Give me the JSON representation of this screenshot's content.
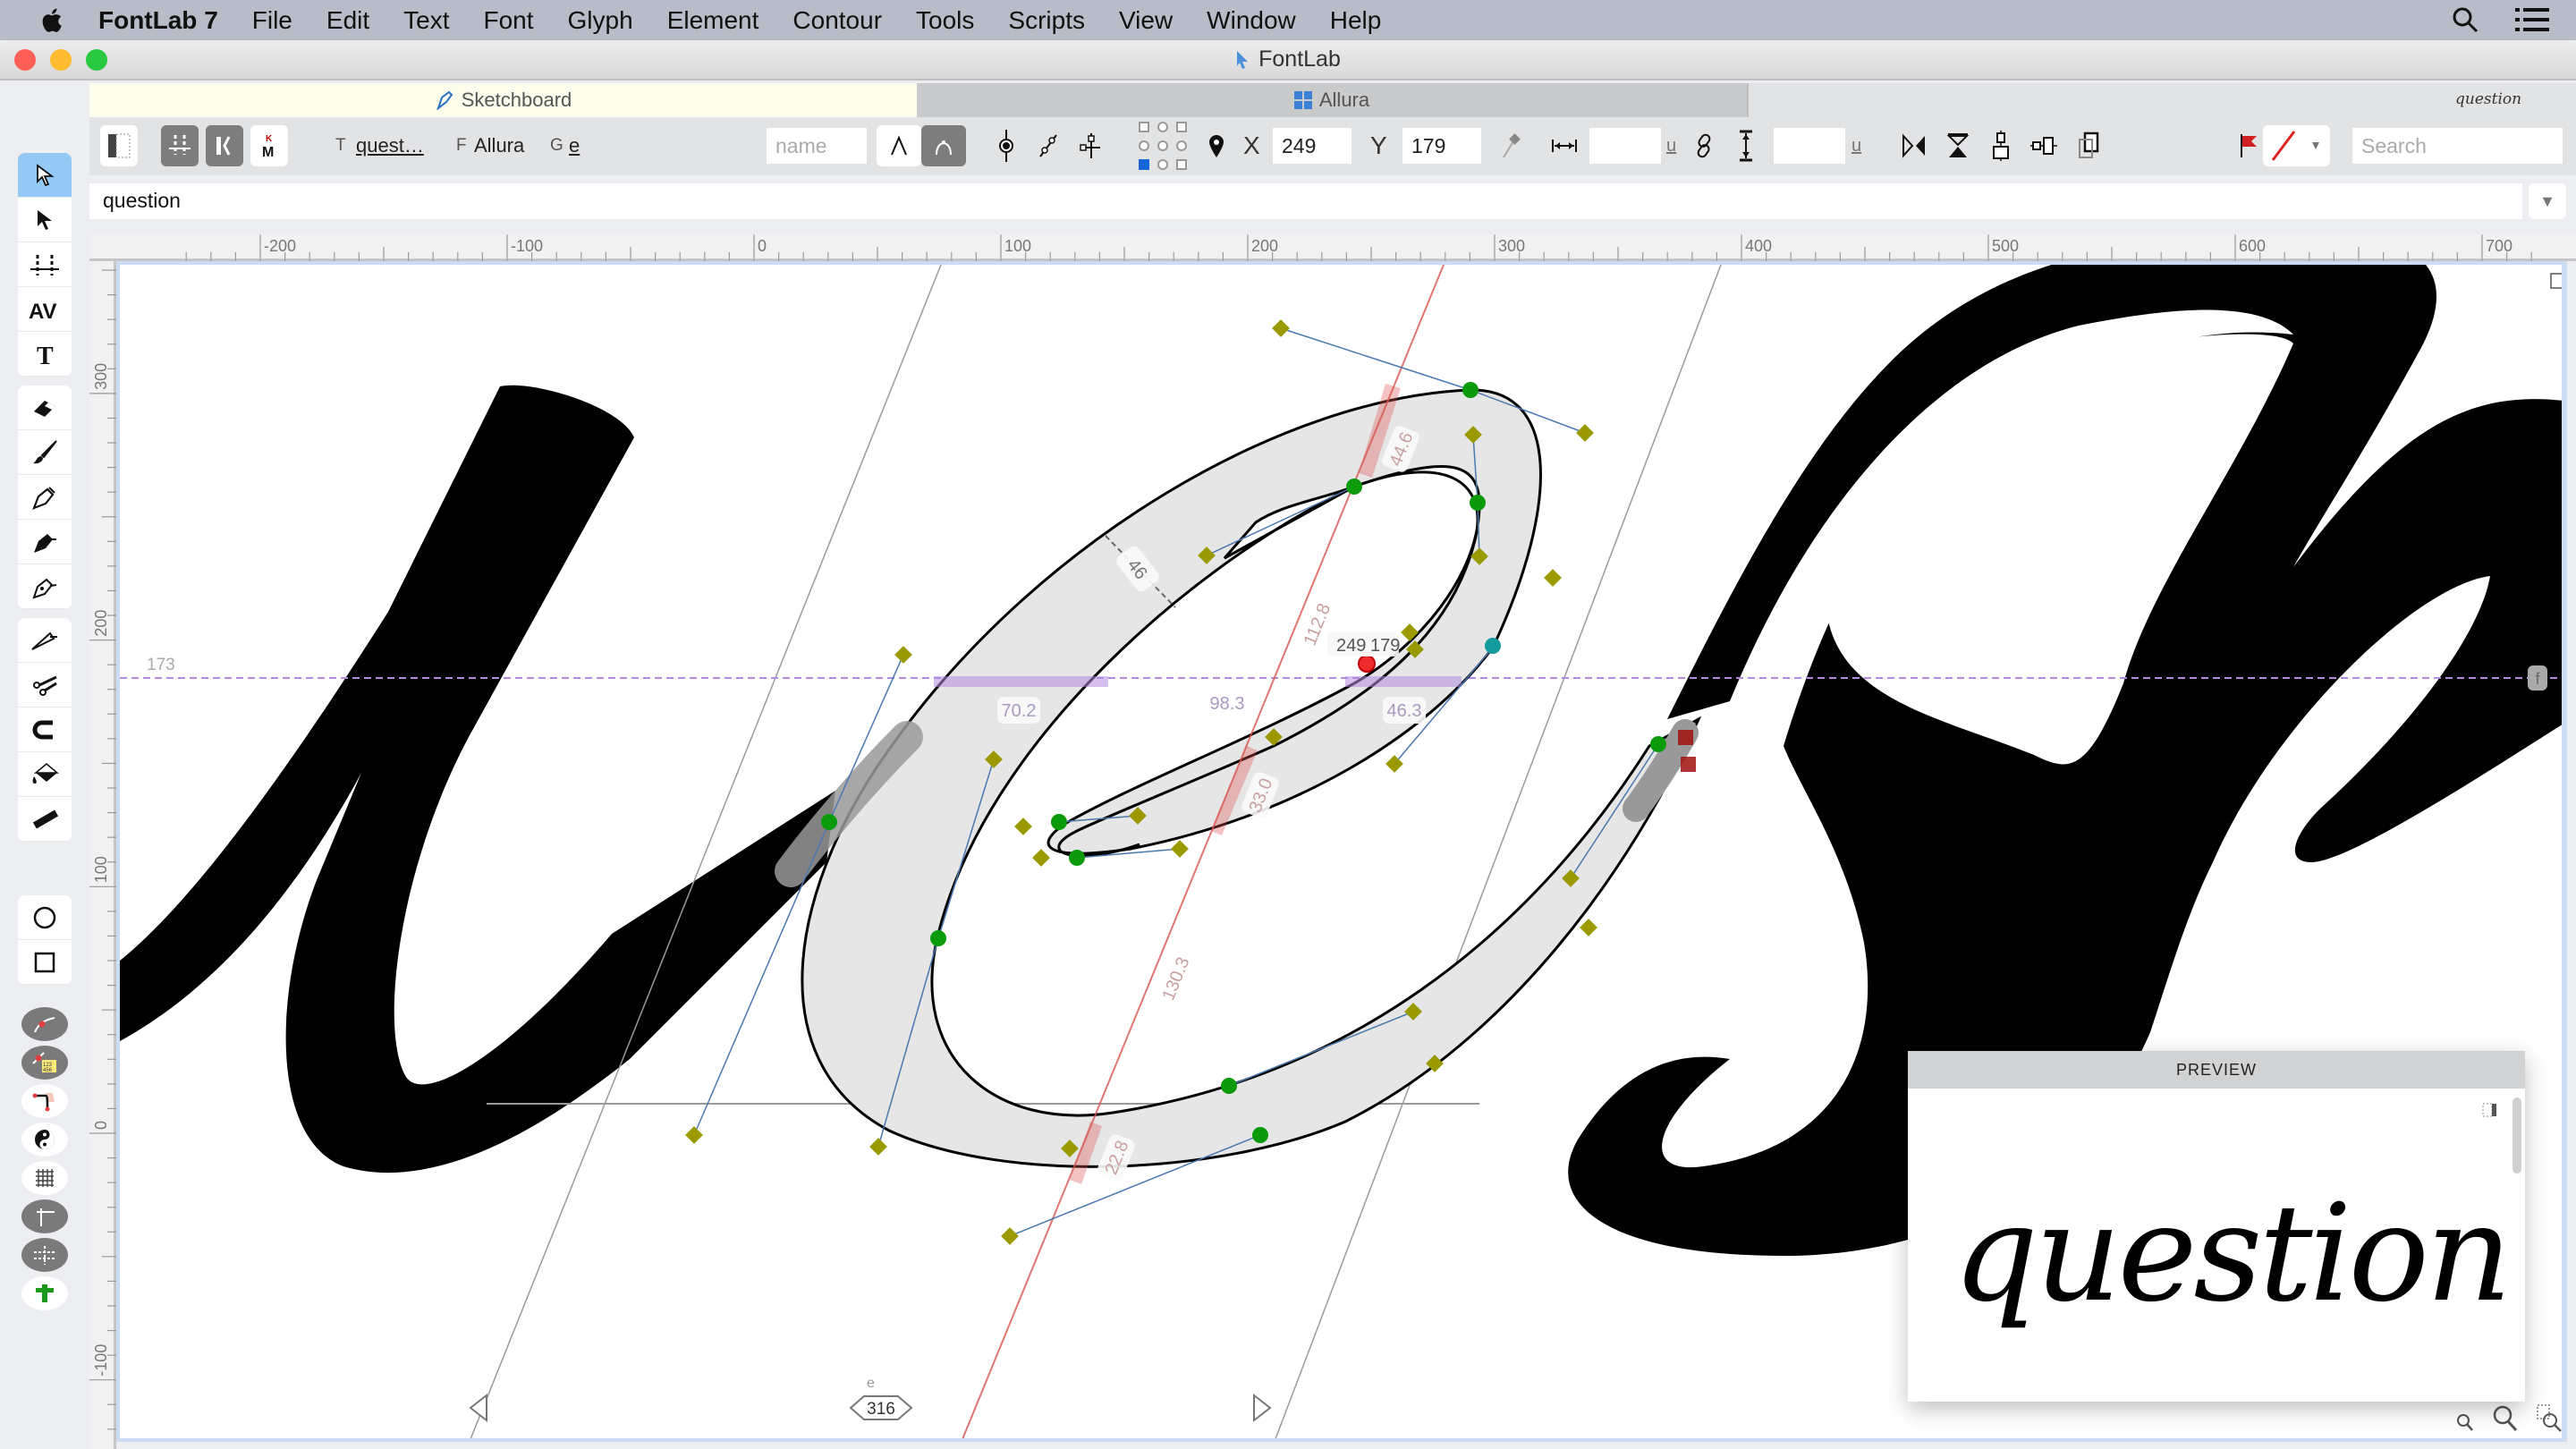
{
  "menubar": {
    "app_name": "FontLab 7",
    "items": [
      "File",
      "Edit",
      "Text",
      "Font",
      "Glyph",
      "Element",
      "Contour",
      "Tools",
      "Scripts",
      "View",
      "Window",
      "Help"
    ]
  },
  "window": {
    "title": "FontLab"
  },
  "tabs": [
    {
      "label": "Sketchboard",
      "icon": "pen-icon",
      "active": true
    },
    {
      "label": "Allura",
      "icon": "font-grid-icon",
      "active": false
    }
  ],
  "tab_preview_text": "question",
  "toolbar": {
    "text_label": "T",
    "text_value": "quest…",
    "font_label": "F",
    "font_value": "Allura",
    "glyph_label": "G",
    "glyph_value": "e",
    "name_placeholder": "name",
    "x_label": "X",
    "x_value": "249",
    "y_label": "Y",
    "y_value": "179",
    "width_value": "",
    "width_unit": "u",
    "height_value": "",
    "height_unit": "u",
    "search_placeholder": "Search"
  },
  "text_line": {
    "value": "question"
  },
  "rulers": {
    "horizontal_ticks": [
      "-200",
      "-100",
      "0",
      "100",
      "200",
      "300",
      "400",
      "500",
      "600",
      "700"
    ],
    "vertical_ticks": [
      "300",
      "200",
      "100",
      "0",
      "-100"
    ],
    "guide_label": "173"
  },
  "canvas": {
    "glyph_name": "e",
    "advance_width": "316",
    "selected_node": {
      "x": "249",
      "y": "179"
    },
    "measurements": [
      "46",
      "44.6",
      "112.8",
      "70.2",
      "98.3",
      "46.3",
      "33.0",
      "130.3",
      "22.8"
    ],
    "font_badge": "f",
    "colors": {
      "node_smooth": "#0a9a0a",
      "node_handle": "#9a9a00",
      "node_selected": "#ee2a2a",
      "node_tangent": "#139a9a",
      "measure_line": "#d9534f",
      "guide": "#b38ae0"
    }
  },
  "preview": {
    "title": "PREVIEW",
    "text": "question"
  }
}
